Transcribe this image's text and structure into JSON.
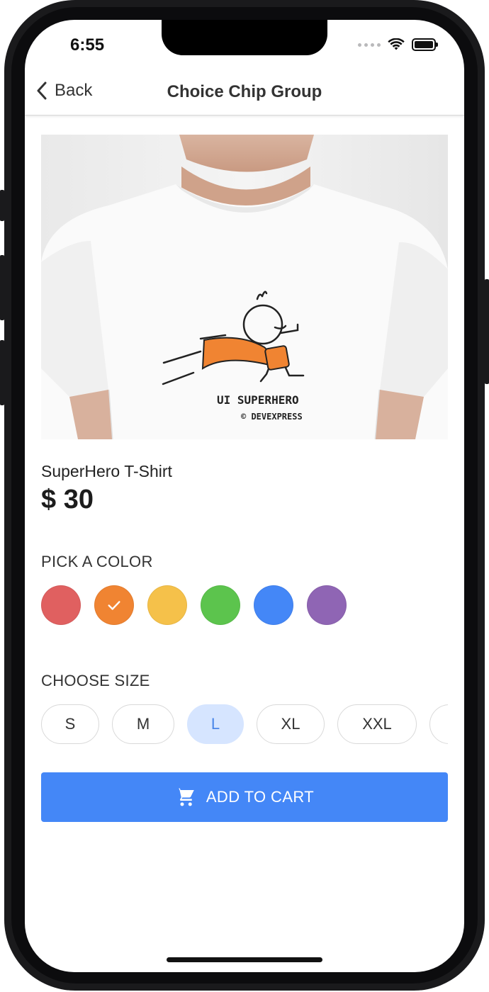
{
  "status_bar": {
    "time": "6:55"
  },
  "nav": {
    "back_label": "Back",
    "title": "Choice Chip Group"
  },
  "product": {
    "image_text_line1": "UI SUPERHERO",
    "image_text_line2": "© DEVEXPRESS",
    "name": "SuperHero T-Shirt",
    "price": "$ 30"
  },
  "color_section": {
    "label": "PICK A COLOR",
    "colors": [
      "#e06060",
      "#f08432",
      "#f5c14a",
      "#5cc44d",
      "#4487f7",
      "#8f65b4"
    ],
    "selected_index": 1
  },
  "size_section": {
    "label": "CHOOSE SIZE",
    "sizes": [
      "S",
      "M",
      "L",
      "XL",
      "XXL",
      ""
    ],
    "selected": "L"
  },
  "cart_button": {
    "label": "ADD TO CART",
    "icon": "cart-icon"
  }
}
